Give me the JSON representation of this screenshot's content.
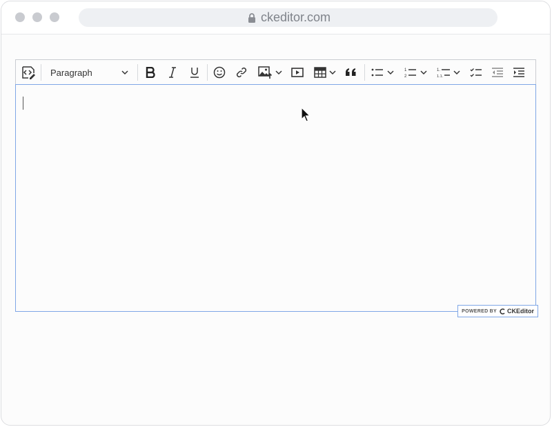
{
  "browser": {
    "url": "ckeditor.com"
  },
  "toolbar": {
    "heading_selected": "Paragraph",
    "buttons": [
      "Source",
      "Bold",
      "Italic",
      "Underline",
      "Emoji",
      "Link",
      "Insert image",
      "Media embed",
      "Insert table",
      "Block quote",
      "Bulleted list",
      "Numbered list",
      "Multi-level list",
      "To-do list",
      "Decrease indent",
      "Increase indent"
    ]
  },
  "editor": {
    "content": ""
  },
  "badge": {
    "label": "POWERED BY",
    "brand": "CKEditor"
  }
}
